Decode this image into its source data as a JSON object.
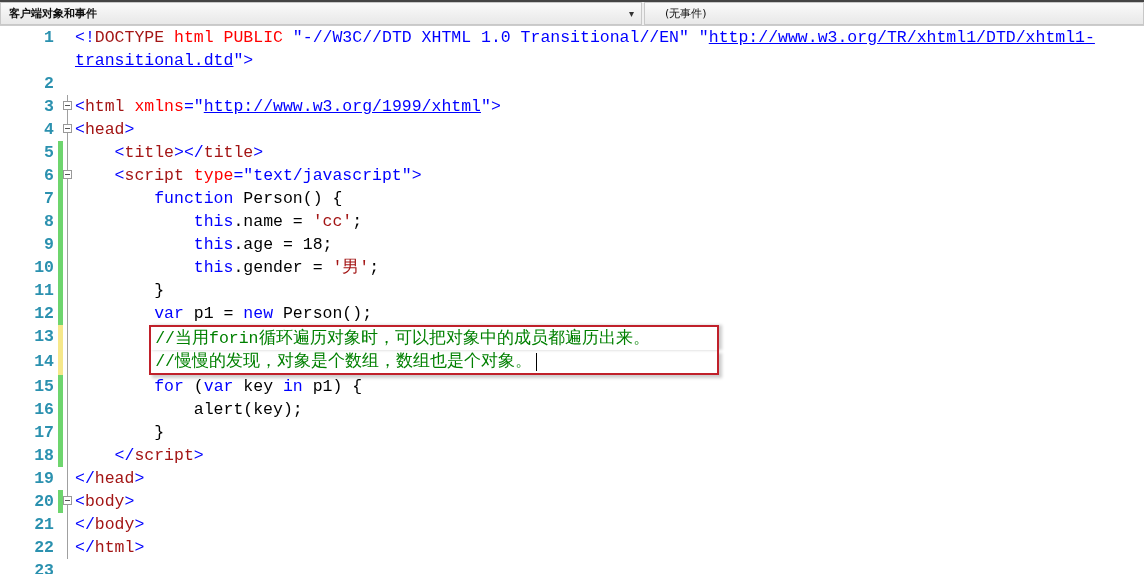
{
  "toolbar": {
    "object_dropdown": {
      "value": "客户端对象和事件",
      "arrow": "▾"
    },
    "event_dropdown": {
      "value": "(无事件)"
    }
  },
  "lines": [
    {
      "number": "1",
      "changed": false,
      "foldable": false,
      "boxed": false,
      "cursor": false,
      "tokens": [
        {
          "kind": "punct",
          "text": "<!"
        },
        {
          "kind": "tag",
          "text": "DOCTYPE"
        },
        {
          "kind": "attr",
          "text": " html PUBLIC "
        },
        {
          "kind": "value",
          "text": "\"-//W3C//DTD XHTML 1.0 Transitional//EN\" \""
        },
        {
          "kind": "link",
          "text": "http://www.w3.org/TR/xhtml1/DTD/xhtml1-transitional.dtd"
        },
        {
          "kind": "value",
          "text": "\""
        },
        {
          "kind": "punct",
          "text": ">"
        }
      ]
    },
    {
      "number": "2",
      "changed": false,
      "foldable": false,
      "boxed": false,
      "cursor": false
    },
    {
      "number": "3",
      "changed": false,
      "foldable": true,
      "boxed": false,
      "cursor": false,
      "tokens": [
        {
          "kind": "punct",
          "text": "<"
        },
        {
          "kind": "tag",
          "text": "html"
        },
        {
          "kind": "attr",
          "text": " xmlns"
        },
        {
          "kind": "punct",
          "text": "=\""
        },
        {
          "kind": "link",
          "text": "http://www.w3.org/1999/xhtml"
        },
        {
          "kind": "punct",
          "text": "\">"
        }
      ]
    },
    {
      "number": "4",
      "changed": false,
      "foldable": true,
      "boxed": false,
      "cursor": false,
      "tokens": [
        {
          "kind": "punct",
          "text": "<"
        },
        {
          "kind": "tag",
          "text": "head"
        },
        {
          "kind": "punct",
          "text": ">"
        }
      ],
      "children": [
        {
          "number": "5",
          "changed": true,
          "saved": true,
          "foldable": false,
          "boxed": false,
          "cursor": false,
          "tokens": [
            {
              "kind": "punct",
              "text": "<"
            },
            {
              "kind": "tag",
              "text": "title"
            },
            {
              "kind": "punct",
              "text": "></"
            },
            {
              "kind": "tag",
              "text": "title"
            },
            {
              "kind": "punct",
              "text": ">"
            }
          ]
        },
        {
          "number": "6",
          "changed": true,
          "saved": true,
          "foldable": true,
          "boxed": false,
          "cursor": false,
          "tokens": [
            {
              "kind": "punct",
              "text": "<"
            },
            {
              "kind": "tag",
              "text": "script"
            },
            {
              "kind": "attr",
              "text": " type"
            },
            {
              "kind": "punct",
              "text": "="
            },
            {
              "kind": "value",
              "text": "\"text/javascript\""
            },
            {
              "kind": "punct",
              "text": ">"
            }
          ],
          "children": [
            {
              "number": "7",
              "changed": true,
              "saved": true,
              "foldable": false,
              "boxed": false,
              "cursor": false,
              "tokens": [
                {
                  "kind": "keyword",
                  "text": "function"
                },
                {
                  "kind": "plain",
                  "text": " Person() {"
                }
              ],
              "children": [
                {
                  "number": "8",
                  "changed": true,
                  "saved": true,
                  "foldable": false,
                  "boxed": false,
                  "cursor": false,
                  "tokens": [
                    {
                      "kind": "keyword",
                      "text": "this"
                    },
                    {
                      "kind": "plain",
                      "text": ".name = "
                    },
                    {
                      "kind": "string",
                      "text": "'cc'"
                    },
                    {
                      "kind": "plain",
                      "text": ";"
                    }
                  ]
                },
                {
                  "number": "9",
                  "changed": true,
                  "saved": true,
                  "foldable": false,
                  "boxed": false,
                  "cursor": false,
                  "tokens": [
                    {
                      "kind": "keyword",
                      "text": "this"
                    },
                    {
                      "kind": "plain",
                      "text": ".age = 18;"
                    }
                  ]
                },
                {
                  "number": "10",
                  "changed": true,
                  "saved": true,
                  "foldable": false,
                  "boxed": false,
                  "cursor": false,
                  "tokens": [
                    {
                      "kind": "keyword",
                      "text": "this"
                    },
                    {
                      "kind": "plain",
                      "text": ".gender = "
                    },
                    {
                      "kind": "string",
                      "text": "'男'"
                    },
                    {
                      "kind": "plain",
                      "text": ";"
                    }
                  ]
                }
              ]
            },
            {
              "number": "11",
              "changed": true,
              "saved": true,
              "foldable": false,
              "boxed": false,
              "cursor": false,
              "tokens": [
                {
                  "kind": "plain",
                  "text": "}"
                }
              ]
            },
            {
              "number": "12",
              "changed": true,
              "saved": true,
              "foldable": false,
              "boxed": false,
              "cursor": false,
              "tokens": [
                {
                  "kind": "keyword",
                  "text": "var"
                },
                {
                  "kind": "plain",
                  "text": " p1 = "
                },
                {
                  "kind": "keyword",
                  "text": "new"
                },
                {
                  "kind": "plain",
                  "text": " Person();"
                }
              ]
            },
            {
              "number": "13",
              "changed": true,
              "saved": false,
              "foldable": false,
              "boxed": true,
              "cursor": false,
              "tokens": [
                {
                  "kind": "comment",
                  "text": "//当用forin循环遍历对象时，可以把对象中的成员都遍历出来。"
                }
              ]
            },
            {
              "number": "14",
              "changed": true,
              "saved": false,
              "foldable": false,
              "boxed": true,
              "cursor": true,
              "tokens": [
                {
                  "kind": "comment",
                  "text": "//慢慢的发现，对象是个数组，数组也是个对象。"
                }
              ]
            },
            {
              "number": "15",
              "changed": true,
              "saved": true,
              "foldable": false,
              "boxed": false,
              "cursor": false,
              "tokens": [
                {
                  "kind": "keyword",
                  "text": "for"
                },
                {
                  "kind": "plain",
                  "text": " ("
                },
                {
                  "kind": "keyword",
                  "text": "var"
                },
                {
                  "kind": "plain",
                  "text": " key "
                },
                {
                  "kind": "keyword",
                  "text": "in"
                },
                {
                  "kind": "plain",
                  "text": " p1) {"
                }
              ],
              "children": [
                {
                  "number": "16",
                  "changed": true,
                  "saved": true,
                  "foldable": false,
                  "boxed": false,
                  "cursor": false,
                  "tokens": [
                    {
                      "kind": "plain",
                      "text": "alert(key);"
                    }
                  ]
                }
              ]
            },
            {
              "number": "17",
              "changed": true,
              "saved": true,
              "foldable": false,
              "boxed": false,
              "cursor": false,
              "tokens": [
                {
                  "kind": "plain",
                  "text": "}"
                }
              ]
            }
          ]
        },
        {
          "number": "18",
          "changed": true,
          "saved": true,
          "foldable": false,
          "boxed": false,
          "cursor": false,
          "tokens": [
            {
              "kind": "punct",
              "text": "</"
            },
            {
              "kind": "tag",
              "text": "script"
            },
            {
              "kind": "punct",
              "text": ">"
            }
          ]
        }
      ]
    },
    {
      "number": "19",
      "changed": false,
      "foldable": false,
      "boxed": false,
      "cursor": false,
      "tokens": [
        {
          "kind": "punct",
          "text": "</"
        },
        {
          "kind": "tag",
          "text": "head"
        },
        {
          "kind": "punct",
          "text": ">"
        }
      ]
    },
    {
      "number": "20",
      "changed": true,
      "saved": true,
      "foldable": true,
      "boxed": false,
      "cursor": false,
      "tokens": [
        {
          "kind": "punct",
          "text": "<"
        },
        {
          "kind": "tag",
          "text": "body"
        },
        {
          "kind": "punct",
          "text": ">"
        }
      ]
    },
    {
      "number": "21",
      "changed": false,
      "foldable": false,
      "boxed": false,
      "cursor": false,
      "tokens": [
        {
          "kind": "punct",
          "text": "</"
        },
        {
          "kind": "tag",
          "text": "body"
        },
        {
          "kind": "punct",
          "text": ">"
        }
      ]
    },
    {
      "number": "22",
      "changed": false,
      "foldable": false,
      "boxed": false,
      "cursor": false,
      "tokens": [
        {
          "kind": "punct",
          "text": "</"
        },
        {
          "kind": "tag",
          "text": "html"
        },
        {
          "kind": "punct",
          "text": ">"
        }
      ]
    },
    {
      "number": "23",
      "changed": false,
      "foldable": false,
      "boxed": false,
      "cursor": false
    }
  ]
}
